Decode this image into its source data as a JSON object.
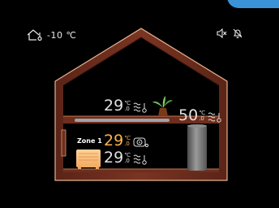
{
  "outdoor": {
    "temperature": "-10",
    "unit": "℃",
    "icon": "house-thermometer-icon"
  },
  "status_icons": [
    "speaker-muted-icon",
    "bell-off-icon"
  ],
  "upper_floor": {
    "temperature_int": "29",
    "temperature_decimal": ".0",
    "unit": "℃",
    "icon": "floor-heating-icon"
  },
  "tank": {
    "temperature_int": "50",
    "temperature_decimal": ".0",
    "unit": "℃",
    "icon": "tank-heating-icon"
  },
  "zone1": {
    "label": "Zone 1",
    "temperature_int": "29",
    "temperature_decimal": ".0",
    "unit": "℃",
    "icon": "thermostat-icon",
    "color": "#ffb347"
  },
  "zone_lower": {
    "temperature_int": "29",
    "temperature_decimal": ".0",
    "unit": "℃",
    "icon": "floor-heating-icon"
  },
  "colors": {
    "house_frame": "#6b2a1a",
    "house_edge": "#e7b48e",
    "accent": "#3a93d6"
  }
}
